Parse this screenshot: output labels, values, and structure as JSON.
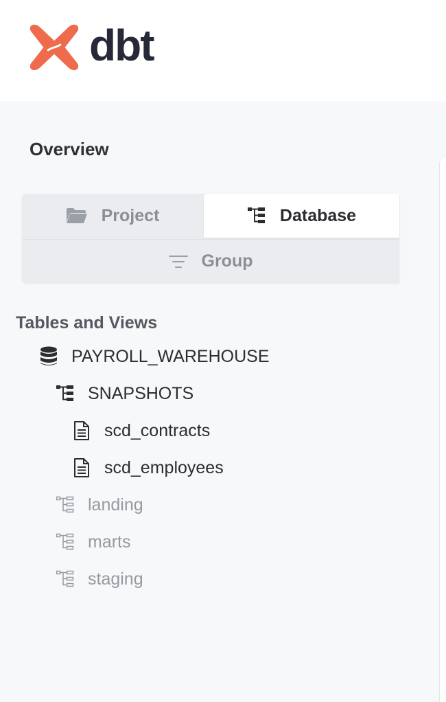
{
  "header": {
    "logo_text": "dbt",
    "brand_color": "#ee6b4d"
  },
  "sidebar": {
    "title": "Overview",
    "tabs": {
      "project": "Project",
      "database": "Database",
      "group": "Group",
      "active": "Database"
    },
    "section_label": "Tables and Views",
    "tree": {
      "database": "PAYROLL_WAREHOUSE",
      "schemas": [
        {
          "label": "SNAPSHOTS",
          "expanded": true,
          "tables": [
            "scd_contracts",
            "scd_employees"
          ]
        },
        {
          "label": "landing",
          "expanded": false
        },
        {
          "label": "marts",
          "expanded": false
        },
        {
          "label": "staging",
          "expanded": false
        }
      ]
    }
  }
}
